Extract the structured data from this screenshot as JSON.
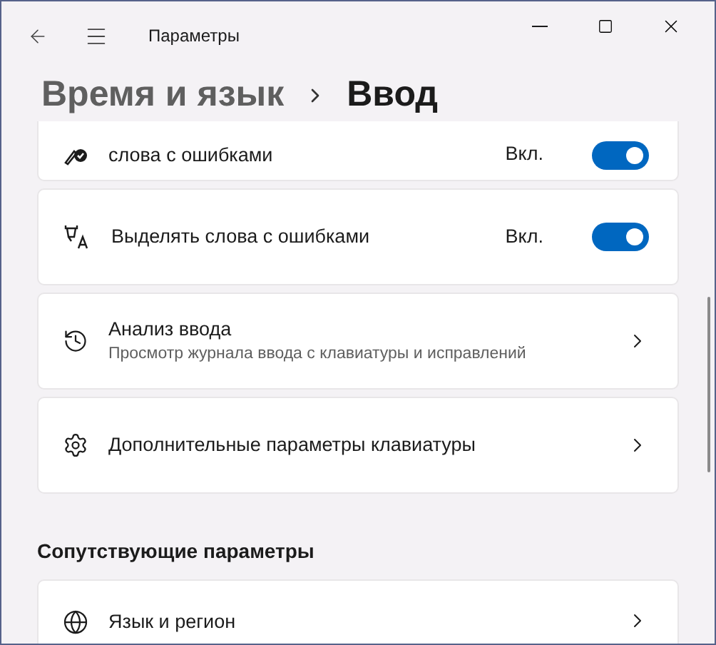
{
  "window": {
    "title": "Параметры"
  },
  "breadcrumb": [
    {
      "label": "Время и язык",
      "current": false
    },
    {
      "label": "Ввод",
      "current": true
    }
  ],
  "settings": [
    {
      "kind": "toggle",
      "label": "слова с ошибками",
      "state_label": "Вкл.",
      "on": true
    },
    {
      "kind": "toggle",
      "label": "Выделять слова с ошибками",
      "state_label": "Вкл.",
      "on": true
    },
    {
      "kind": "link",
      "label": "Анализ ввода",
      "description": "Просмотр журнала ввода с клавиатуры и исправлений"
    },
    {
      "kind": "link",
      "label": "Дополнительные параметры клавиатуры"
    }
  ],
  "related": {
    "heading": "Сопутствующие параметры",
    "items": [
      {
        "kind": "link",
        "label": "Язык и регион"
      }
    ]
  }
}
